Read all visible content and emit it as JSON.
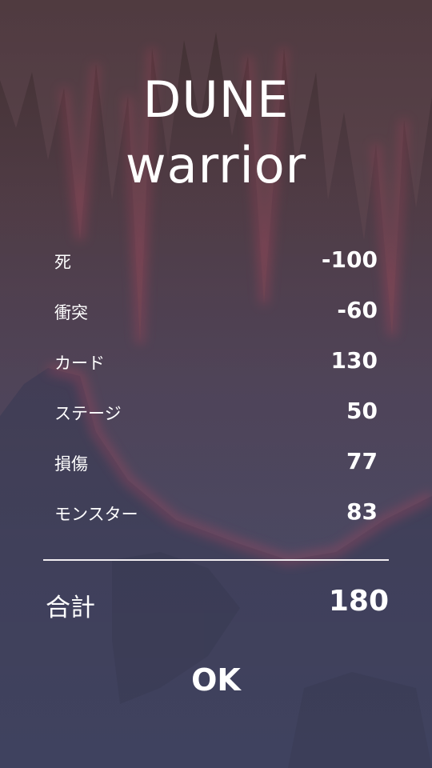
{
  "title": {
    "line1": "DUNE",
    "line2": "warrior"
  },
  "score_rows": [
    {
      "label": "死",
      "value": "-100"
    },
    {
      "label": "衝突",
      "value": "-60"
    },
    {
      "label": "カード",
      "value": "130"
    },
    {
      "label": "ステージ",
      "value": "50"
    },
    {
      "label": "損傷",
      "value": "77"
    },
    {
      "label": "モンスター",
      "value": "83"
    }
  ],
  "total": {
    "label": "合計",
    "value": "180"
  },
  "ok_button": {
    "label": "OK"
  },
  "colors": {
    "background_top": "#4a3638",
    "background_bottom": "#454a68",
    "text": "#ffffff",
    "accent_glow": "#b04a62"
  }
}
